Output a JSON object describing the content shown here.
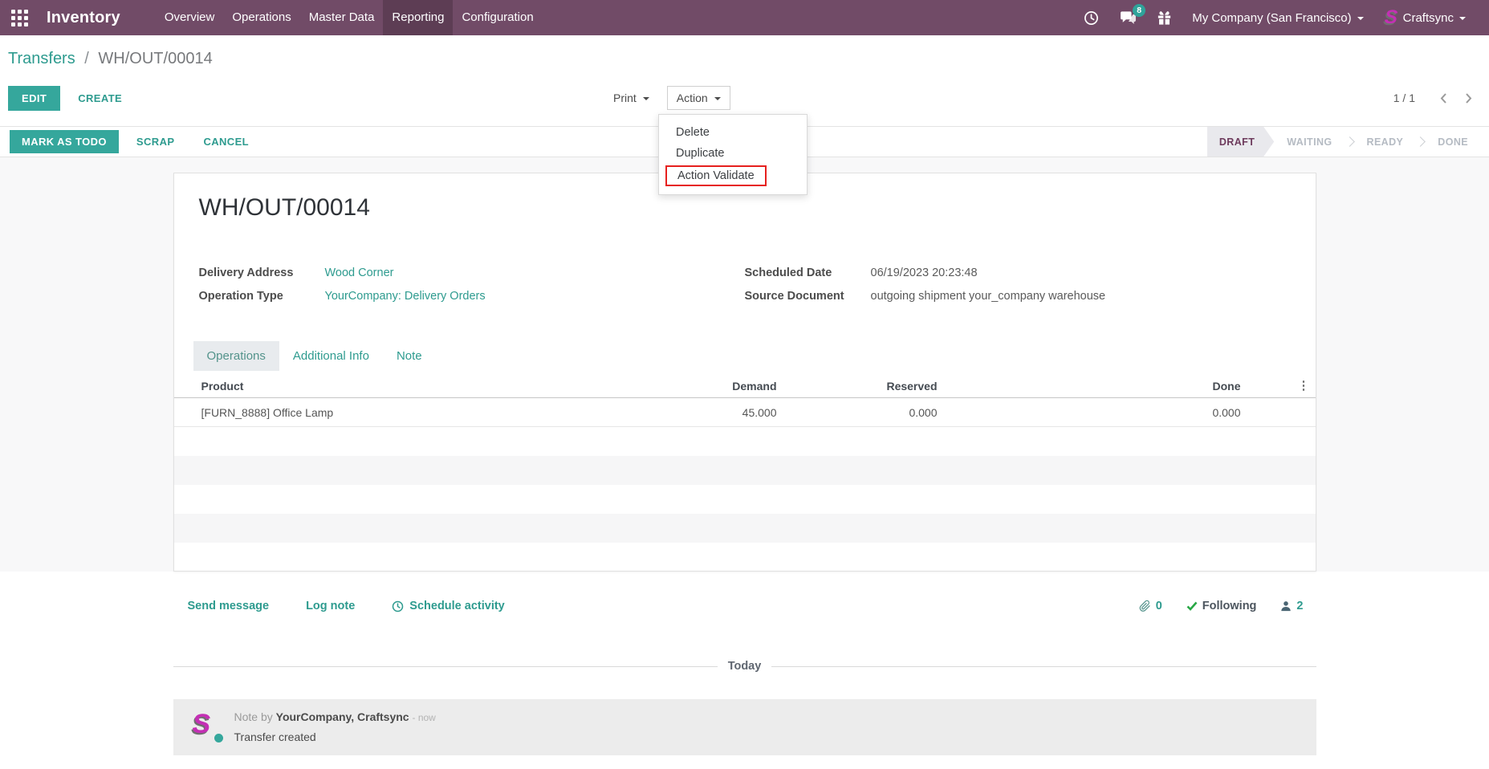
{
  "navbar": {
    "app": "Inventory",
    "menu": [
      {
        "label": "Overview"
      },
      {
        "label": "Operations"
      },
      {
        "label": "Master Data"
      },
      {
        "label": "Reporting"
      },
      {
        "label": "Configuration"
      }
    ],
    "messages_badge": "8",
    "company": "My Company (San Francisco)",
    "user": "Craftsync"
  },
  "breadcrumb": {
    "parent": "Transfers",
    "separator": "/",
    "current": "WH/OUT/00014"
  },
  "controls": {
    "edit": "EDIT",
    "create": "CREATE",
    "print": "Print",
    "action": "Action",
    "pager": "1 / 1"
  },
  "action_menu": {
    "delete": "Delete",
    "duplicate": "Duplicate",
    "validate": "Action Validate"
  },
  "statusbar": {
    "mark_as_todo": "MARK AS TODO",
    "scrap": "SCRAP",
    "cancel": "CANCEL",
    "states": [
      {
        "label": "DRAFT",
        "active": true
      },
      {
        "label": "WAITING",
        "active": false
      },
      {
        "label": "READY",
        "active": false
      },
      {
        "label": "DONE",
        "active": false
      }
    ]
  },
  "form": {
    "title": "WH/OUT/00014",
    "fields": [
      {
        "label": "Delivery Address",
        "value": "Wood Corner"
      },
      {
        "label": "Operation Type",
        "value": "YourCompany: Delivery Orders"
      },
      {
        "label": "Scheduled Date",
        "value": "06/19/2023 20:23:48"
      },
      {
        "label": "Source Document",
        "value": "outgoing shipment your_company warehouse"
      }
    ],
    "tabs": [
      {
        "label": "Operations",
        "active": true
      },
      {
        "label": "Additional Info",
        "active": false
      },
      {
        "label": "Note",
        "active": false
      }
    ],
    "table": {
      "headers": [
        "Product",
        "Demand",
        "Reserved",
        "Done"
      ],
      "rows": [
        {
          "product": "[FURN_8888] Office Lamp",
          "demand": "45.000",
          "reserved": "0.000",
          "done": "0.000"
        }
      ]
    }
  },
  "chatter": {
    "send_message": "Send message",
    "log_note": "Log note",
    "schedule_activity": "Schedule activity",
    "attachments_count": "0",
    "following": "Following",
    "followers_count": "2",
    "divider": "Today",
    "note": {
      "prefix": "Note by",
      "author": "YourCompany, Craftsync",
      "time": "- now",
      "body": "Transfer created"
    }
  },
  "icons": {
    "more_columns": "⋮"
  },
  "colors": {
    "brand_purple": "#714B67",
    "teal_button": "#35A79C",
    "teal_link": "#2E9B8F",
    "highlight_red": "#E6201E",
    "badge_teal": "#2FA39A",
    "following_green": "#28a745"
  }
}
